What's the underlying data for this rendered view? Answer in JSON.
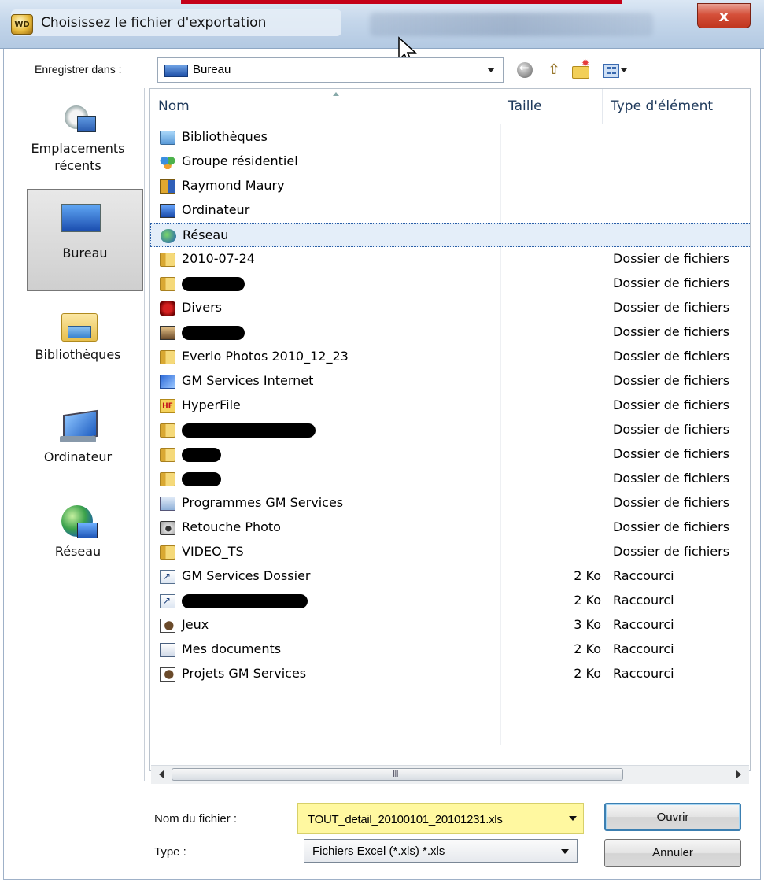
{
  "window": {
    "title": "Choisissez le fichier d'exportation",
    "icon": "app-icon",
    "close_label": "x"
  },
  "toolbar": {
    "save_in_label": "Enregistrer dans :",
    "location": "Bureau"
  },
  "places": [
    {
      "label": "Emplacements récents",
      "icon": "recent-places-icon"
    },
    {
      "label": "Bureau",
      "icon": "desktop-icon",
      "selected": true
    },
    {
      "label": "Bibliothèques",
      "icon": "libraries-icon"
    },
    {
      "label": "Ordinateur",
      "icon": "computer-icon"
    },
    {
      "label": "Réseau",
      "icon": "network-icon"
    }
  ],
  "columns": {
    "name": "Nom",
    "size": "Taille",
    "type": "Type d'élément"
  },
  "files": [
    {
      "name": "Bibliothèques",
      "size": "",
      "type": "",
      "icon": "library"
    },
    {
      "name": "Groupe résidentiel",
      "size": "",
      "type": "",
      "icon": "homegroup"
    },
    {
      "name": "Raymond Maury",
      "size": "",
      "type": "",
      "icon": "user"
    },
    {
      "name": "Ordinateur",
      "size": "",
      "type": "",
      "icon": "computer"
    },
    {
      "name": "Réseau",
      "size": "",
      "type": "",
      "icon": "network",
      "selected": true
    },
    {
      "name": "2010-07-24",
      "size": "",
      "type": "Dossier de fichiers",
      "icon": "folder"
    },
    {
      "name": "",
      "size": "",
      "type": "Dossier de fichiers",
      "icon": "folder",
      "redacted": true
    },
    {
      "name": "Divers",
      "size": "",
      "type": "Dossier de fichiers",
      "icon": "divers"
    },
    {
      "name": "",
      "size": "",
      "type": "Dossier de fichiers",
      "icon": "photo",
      "redacted": true
    },
    {
      "name": "Everio Photos 2010_12_23",
      "size": "",
      "type": "Dossier de fichiers",
      "icon": "folder"
    },
    {
      "name": "GM Services Internet",
      "size": "",
      "type": "Dossier de fichiers",
      "icon": "gm"
    },
    {
      "name": "HyperFile",
      "size": "",
      "type": "Dossier de fichiers",
      "icon": "hf"
    },
    {
      "name": "",
      "size": "",
      "type": "Dossier de fichiers",
      "icon": "folder",
      "redacted": true
    },
    {
      "name": "",
      "size": "",
      "type": "Dossier de fichiers",
      "icon": "folder",
      "redacted": true
    },
    {
      "name": "",
      "size": "",
      "type": "Dossier de fichiers",
      "icon": "folder",
      "redacted": true
    },
    {
      "name": "Programmes  GM Services",
      "size": "",
      "type": "Dossier de fichiers",
      "icon": "prog"
    },
    {
      "name": "Retouche Photo",
      "size": "",
      "type": "Dossier de fichiers",
      "icon": "camera"
    },
    {
      "name": "VIDEO_TS",
      "size": "",
      "type": "Dossier de fichiers",
      "icon": "folder"
    },
    {
      "name": "GM Services  Dossier",
      "size": "2 Ko",
      "type": "Raccourci",
      "icon": "shortcut"
    },
    {
      "name": "",
      "size": "2 Ko",
      "type": "Raccourci",
      "icon": "shortcut",
      "redacted": true
    },
    {
      "name": "Jeux",
      "size": "3 Ko",
      "type": "Raccourci",
      "icon": "games"
    },
    {
      "name": "Mes documents",
      "size": "2 Ko",
      "type": "Raccourci",
      "icon": "docs"
    },
    {
      "name": "Projets GM Services",
      "size": "2 Ko",
      "type": "Raccourci",
      "icon": "games"
    }
  ],
  "scrollbar": {
    "grip": "III"
  },
  "form": {
    "filename_label": "Nom du fichier :",
    "filename_value": "TOUT_detail_20100101_20101231.xls",
    "filename_highlight": "#fff8a0",
    "type_label": "Type :",
    "type_value": "Fichiers Excel (*.xls) *.xls",
    "open_label": "Ouvrir",
    "cancel_label": "Annuler"
  }
}
